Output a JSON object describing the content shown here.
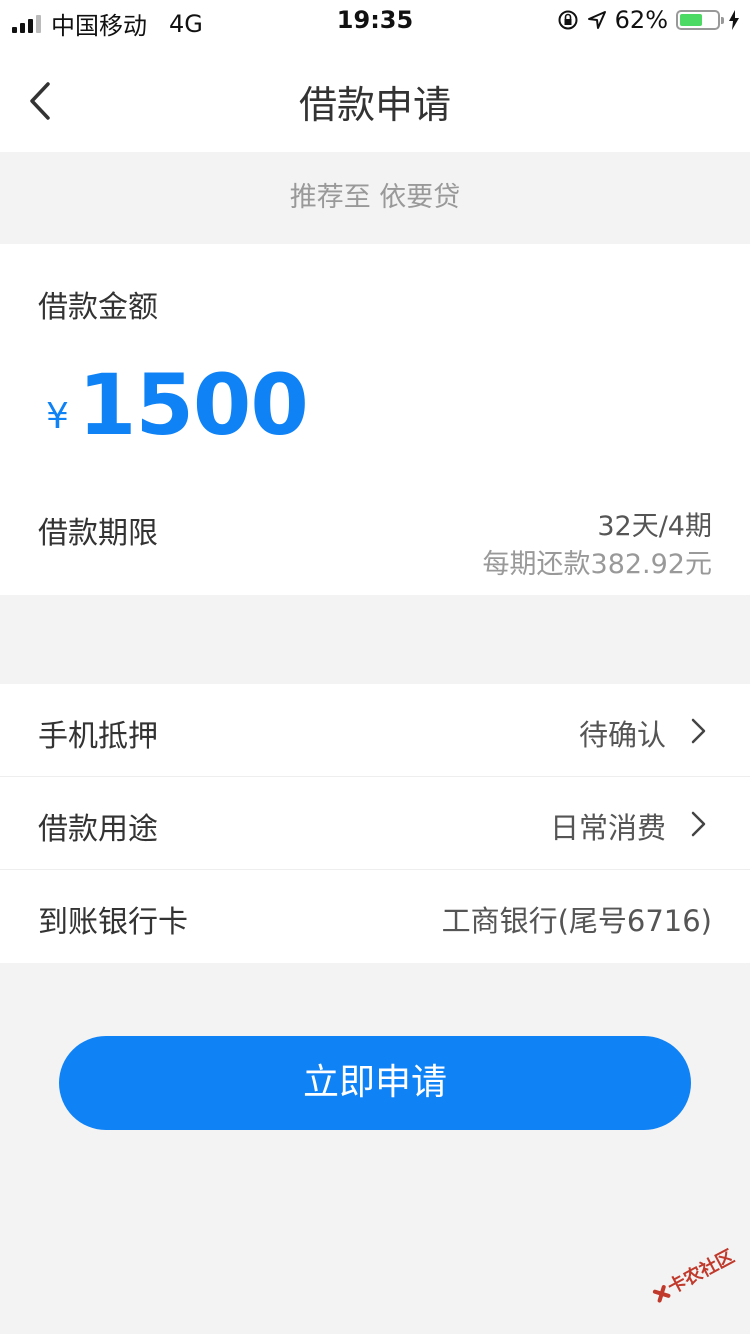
{
  "status_bar": {
    "carrier": "中国移动",
    "network": "4G",
    "time": "19:35",
    "battery_percent": "62%",
    "battery_level": 0.62,
    "icons": [
      "signal-icon",
      "orientation-lock-icon",
      "location-icon",
      "battery-icon",
      "charging-icon"
    ]
  },
  "nav": {
    "title": "借款申请",
    "back_icon": "chevron-left-icon"
  },
  "recommend_text": "推荐至 依要贷",
  "amount": {
    "label": "借款金额",
    "currency": "¥",
    "value": "1500"
  },
  "term": {
    "label": "借款期限",
    "value": "32天/4期",
    "per_period": "每期还款382.92元"
  },
  "rows": [
    {
      "label": "手机抵押",
      "value": "待确认",
      "has_arrow": true
    },
    {
      "label": "借款用途",
      "value": "日常消费",
      "has_arrow": true
    },
    {
      "label": "到账银行卡",
      "value": "工商银行(尾号6716)",
      "has_arrow": false
    }
  ],
  "apply_button": "立即申请",
  "watermark": "卡农社区",
  "colors": {
    "accent": "#0f82f5",
    "background": "#f3f3f3",
    "battery": "#4cd964"
  }
}
